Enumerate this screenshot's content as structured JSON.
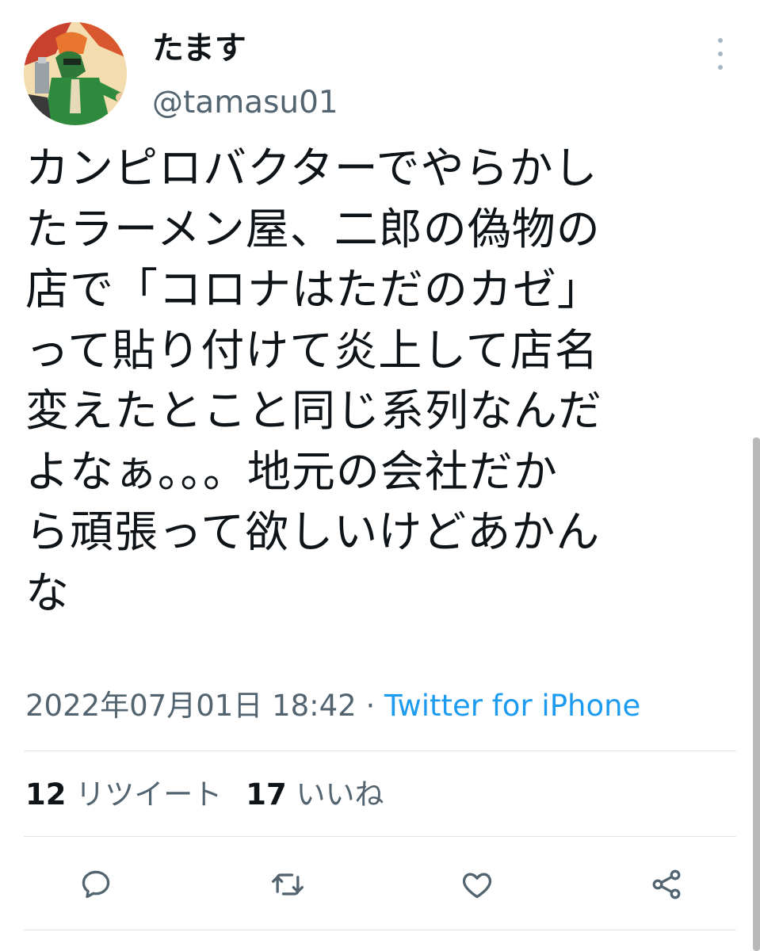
{
  "tweet": {
    "author": {
      "display_name": "たます",
      "handle": "@tamasu01"
    },
    "text_lines": [
      "カンピロバクターでやらかし",
      "たラーメン屋、二郎の偽物の",
      "店で「コロナはただのカゼ」",
      "って貼り付けて炎上して店名",
      "変えたとこと同じ系列なんだ",
      "よなぁ。。。地元の会社だか",
      "ら頑張って欲しいけどあかん",
      "な"
    ],
    "timestamp": "2022年07月01日 18:42",
    "separator": "·",
    "source": "Twitter for iPhone",
    "stats": {
      "retweet_count": "12",
      "retweet_label": "リツイート",
      "like_count": "17",
      "like_label": "いいね"
    }
  },
  "icons": {
    "more": "more-vertical-icon",
    "reply": "reply-icon",
    "retweet": "retweet-icon",
    "like": "like-icon",
    "share": "share-icon"
  },
  "colors": {
    "text": "#0f1419",
    "secondary": "#536471",
    "link": "#1d9bf0",
    "divider": "#e1e4e8"
  }
}
